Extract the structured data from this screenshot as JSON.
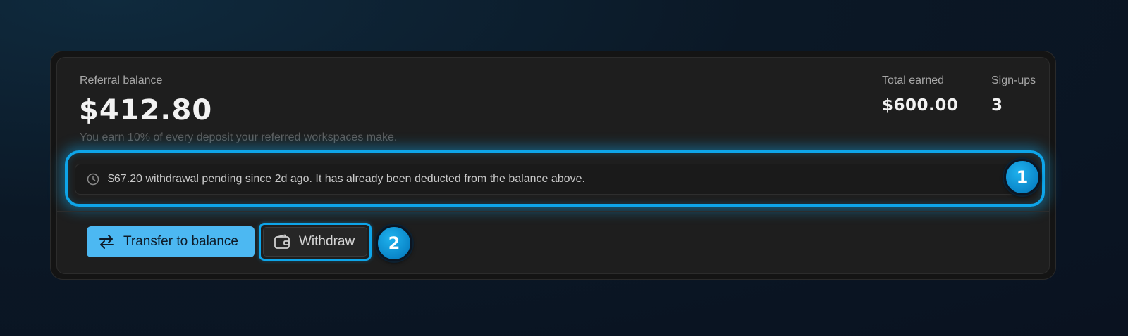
{
  "balance": {
    "label": "Referral balance",
    "amount": "$412.80",
    "subtitle": "You earn 10% of every deposit your referred workspaces make."
  },
  "stats": {
    "total_earned_label": "Total earned",
    "total_earned_value": "$600.00",
    "signups_label": "Sign-ups",
    "signups_value": "3"
  },
  "notice": {
    "icon": "clock-icon",
    "text": "$67.20 withdrawal pending since 2d ago. It has already been deducted from the balance above."
  },
  "actions": {
    "transfer_label": "Transfer to balance",
    "transfer_icon": "swap-arrows-icon",
    "withdraw_label": "Withdraw",
    "withdraw_icon": "wallet-icon"
  },
  "annotations": {
    "badge_1": "1",
    "badge_2": "2"
  },
  "colors": {
    "accent": "#0ea5e9",
    "primary_button": "#4cb8f2",
    "card": "#1e1e1e"
  }
}
